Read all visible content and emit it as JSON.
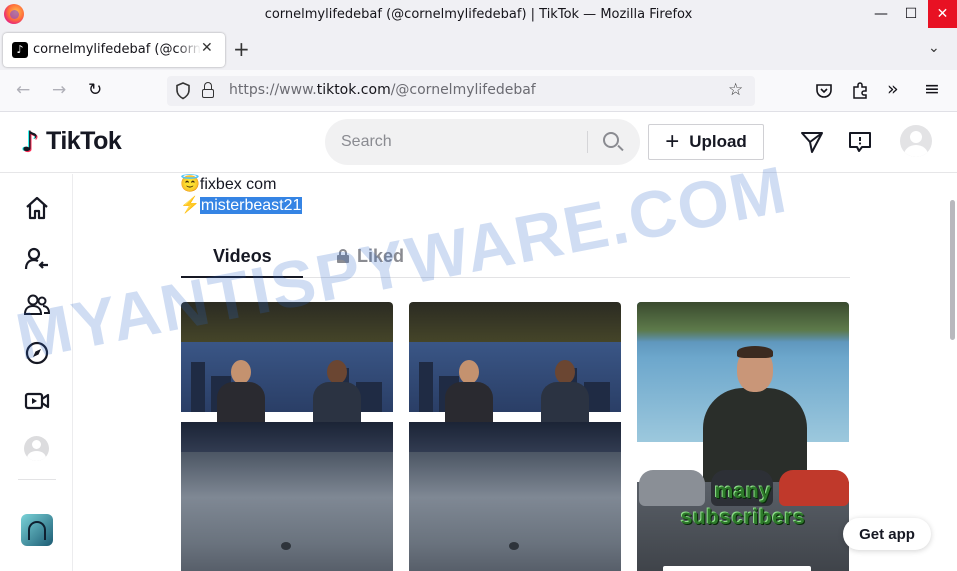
{
  "window": {
    "title": "cornelmylifedebaf (@cornelmylifedebaf) | TikTok — Mozilla Firefox",
    "minimize": "—",
    "maximize": "☐",
    "close": "✕"
  },
  "tab": {
    "title": "cornelmylifedebaf (@cornelmylifedebaf) | TikTok",
    "close": "✕",
    "new_tab": "+",
    "list_all": "⌄"
  },
  "nav": {
    "back": "←",
    "forward": "→",
    "reload": "↻",
    "url_prefix": "https://www.",
    "url_domain": "tiktok.com",
    "url_path": "/@cornelmylifedebaf",
    "bookmark": "☆",
    "pocket": "♡",
    "extensions": "⧉",
    "overflow": "»",
    "menu": "≡"
  },
  "header": {
    "logo_text": "TikTok",
    "search_placeholder": "Search",
    "upload_label": "Upload",
    "upload_plus": "+"
  },
  "profile": {
    "bio_line1_emoji": "😇",
    "bio_line1_text": "fixbex com",
    "bio_line2_emoji": "⚡",
    "bio_line2_text": "misterbeast21",
    "tabs": {
      "videos": "Videos",
      "liked": "Liked"
    }
  },
  "videos": [
    {
      "caption": ""
    },
    {
      "caption": ""
    },
    {
      "caption_line1": "many",
      "caption_line2": "subscribers"
    }
  ],
  "get_app": "Get app",
  "watermark": "MYANTISPYWARE.COM",
  "colors": {
    "highlight": "#3584e4",
    "close_button": "#e81123",
    "tiktok_text": "#161823"
  }
}
